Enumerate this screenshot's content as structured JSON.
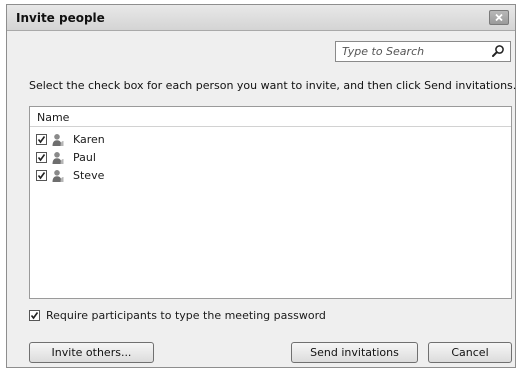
{
  "dialog": {
    "title": "Invite people",
    "close_icon": "close-icon"
  },
  "search": {
    "placeholder": "Type to Search",
    "value": "",
    "icon": "search-icon"
  },
  "instructions": "Select the check box for each person you want to invite, and then click Send invitations.",
  "people_list": {
    "column_header": "Name",
    "rows": [
      {
        "name": "Karen",
        "checked": true,
        "icon": "person-icon"
      },
      {
        "name": "Paul",
        "checked": true,
        "icon": "person-icon"
      },
      {
        "name": "Steve",
        "checked": true,
        "icon": "person-icon"
      }
    ]
  },
  "password_option": {
    "label": "Require participants to type the meeting password",
    "checked": true
  },
  "buttons": {
    "invite_others": "Invite others...",
    "send_invitations": "Send invitations",
    "cancel": "Cancel"
  }
}
